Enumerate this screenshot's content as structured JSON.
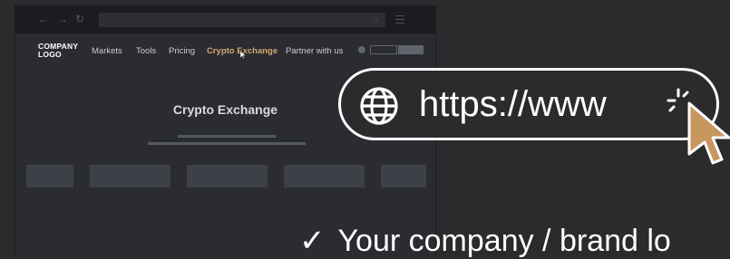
{
  "browser": {
    "back": "←",
    "forward": "→",
    "reload": "↻",
    "star": "☆"
  },
  "site": {
    "logo": "COMPANY LOGO",
    "nav": [
      "Markets",
      "Tools",
      "Pricing",
      "Crypto Exchange",
      "Partner with us"
    ],
    "active_nav": "Crypto Exchange",
    "page_title": "Crypto Exchange"
  },
  "url_overlay": {
    "text": "https://www",
    "icon": "globe-icon"
  },
  "caption": {
    "check": "✓",
    "text": "Your company / brand lo"
  },
  "colors": {
    "accent": "#d2a873",
    "cursor": "#c8965f"
  }
}
